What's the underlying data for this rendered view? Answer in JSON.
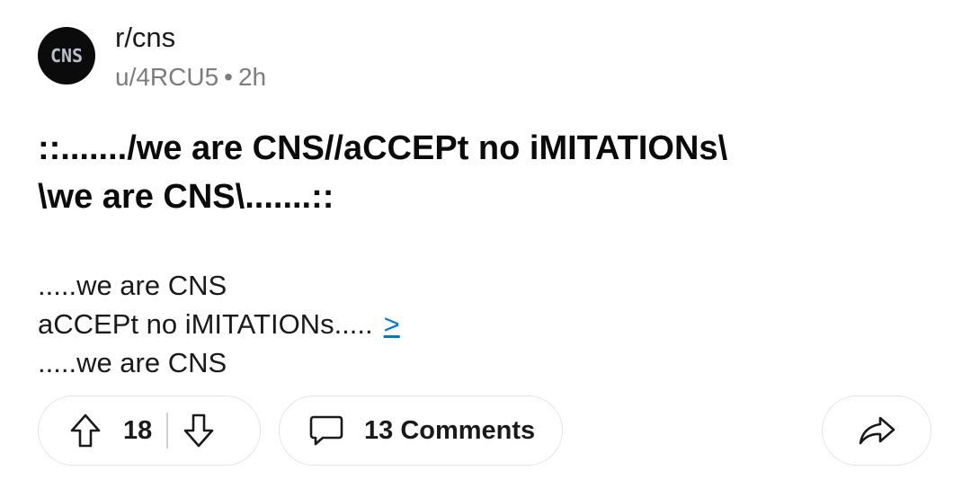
{
  "header": {
    "avatar_text": "CNS",
    "subreddit": "r/cns",
    "author": "u/4RCU5",
    "separator": "•",
    "age": "2h"
  },
  "post": {
    "title_lines": [
      "::......./we are CNS//aCCEPt no iMITATIONs\\",
      "\\we are CNS\\.......::"
    ],
    "body_lines": [
      ".....we are CNS",
      "aCCEPt no iMITATIONs.....",
      ".....we are CNS"
    ],
    "more_link": ">"
  },
  "actions": {
    "vote_count": "18",
    "comments_label": "13 Comments",
    "icons": {
      "upvote": "upvote-arrow-icon",
      "downvote": "downvote-arrow-icon",
      "comments": "speech-bubble-icon",
      "share": "share-arrow-icon"
    }
  },
  "colors": {
    "text": "#1a1a1b",
    "meta": "#7c7c7c",
    "link": "#0079d3",
    "pill_border": "#e3e3e3"
  }
}
